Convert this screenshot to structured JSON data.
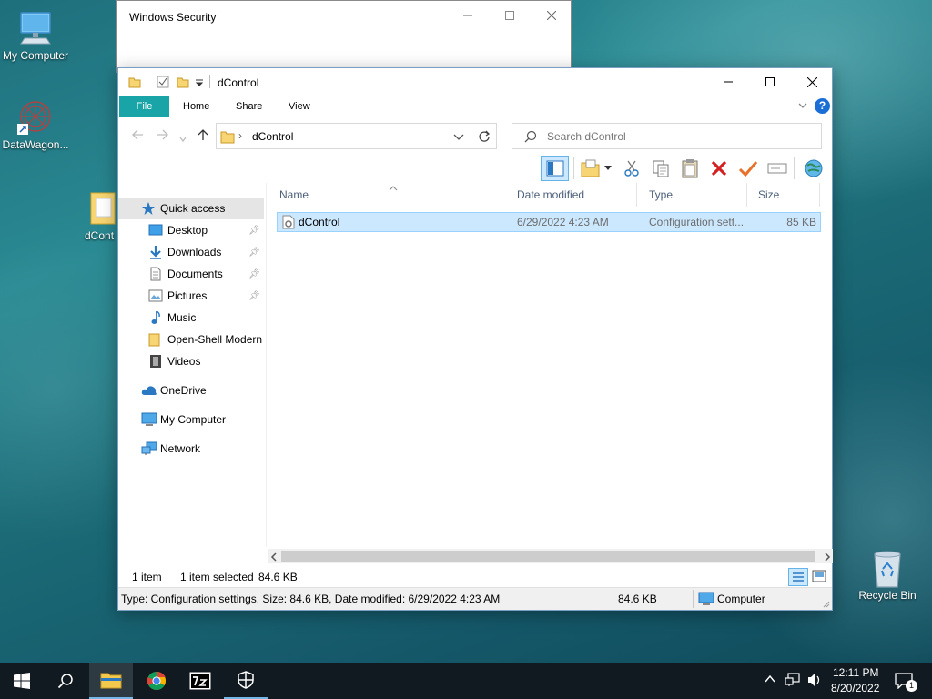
{
  "desktop": {
    "icons": [
      {
        "label": "My Computer"
      },
      {
        "label": "DataWagon..."
      },
      {
        "label": "dCont"
      },
      {
        "label": "Recycle Bin"
      }
    ]
  },
  "security_window": {
    "title": "Windows Security"
  },
  "explorer": {
    "title": "dControl",
    "tabs": [
      "File",
      "Home",
      "Share",
      "View"
    ],
    "address": {
      "path": "dControl"
    },
    "search": {
      "placeholder": "Search dControl"
    },
    "nav": {
      "quick_access": "Quick access",
      "items": [
        {
          "label": "Desktop",
          "pinned": true
        },
        {
          "label": "Downloads",
          "pinned": true
        },
        {
          "label": "Documents",
          "pinned": true
        },
        {
          "label": "Pictures",
          "pinned": true
        },
        {
          "label": "Music",
          "pinned": false
        },
        {
          "label": "Open-Shell Modern",
          "pinned": false
        },
        {
          "label": "Videos",
          "pinned": false
        }
      ],
      "onedrive": "OneDrive",
      "my_computer": "My Computer",
      "network": "Network"
    },
    "columns": [
      "Name",
      "Date modified",
      "Type",
      "Size"
    ],
    "files": [
      {
        "name": "dControl",
        "date": "6/29/2022 4:23 AM",
        "type": "Configuration sett...",
        "size": "85 KB"
      }
    ],
    "status": {
      "count": "1 item",
      "selected": "1 item selected",
      "selected_size": "84.6 KB"
    },
    "details_bar": {
      "text": "Type: Configuration settings, Size: 84.6 KB, Date modified: 6/29/2022 4:23 AM",
      "size": "84.6 KB",
      "location": "Computer"
    }
  },
  "taskbar": {
    "time": "12:11 PM",
    "date": "8/20/2022",
    "notification_count": "1"
  },
  "colors": {
    "accent": "#19a5a8",
    "selection": "#cce8ff",
    "taskbar": "#111a20"
  }
}
